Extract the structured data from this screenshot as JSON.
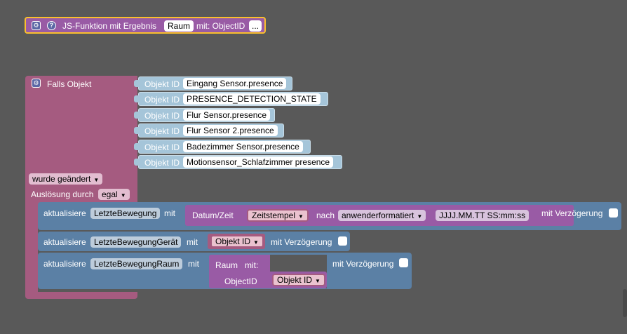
{
  "function_block": {
    "label": "JS-Funktion mit Ergebnis",
    "name": "Raum",
    "param_text": "mit: ObjectID",
    "dots": "..."
  },
  "trigger": {
    "label": "Falls Objekt",
    "object_id_label": "Objekt ID",
    "objects": [
      "Eingang Sensor.presence",
      "PRESENCE_DETECTION_STATE",
      "Flur Sensor.presence",
      "Flur Sensor 2.presence",
      "Badezimmer Sensor.presence",
      "Motionsensor_Schlafzimmer presence"
    ],
    "condition": "wurde geändert",
    "trigger_by_label": "Auslösung durch",
    "trigger_by_value": "egal"
  },
  "statements": {
    "update_label": "aktualisiere",
    "with_label": "mit",
    "delay_label": "mit Verzögerung",
    "stmt1": {
      "var": "LetzteBewegung",
      "date_label": "Datum/Zeit",
      "date_value": "Zeitstempel",
      "after_label": "nach",
      "format_select": "anwenderformatiert",
      "format_string": "JJJJ.MM.TT SS:mm:ss"
    },
    "stmt2": {
      "var": "LetzteBewegungGerät",
      "value": "Objekt ID"
    },
    "stmt3": {
      "var": "LetzteBewegungRaum",
      "func_name": "Raum",
      "func_with": "mit:",
      "param_name": "ObjectID",
      "param_value": "Objekt ID"
    }
  },
  "colors": {
    "background": "#595959",
    "trigger": "#a55b80",
    "statement": "#5b80a5",
    "function": "#995ba5",
    "object_id": "#a5c5d9",
    "highlight": "#fbc02d"
  }
}
